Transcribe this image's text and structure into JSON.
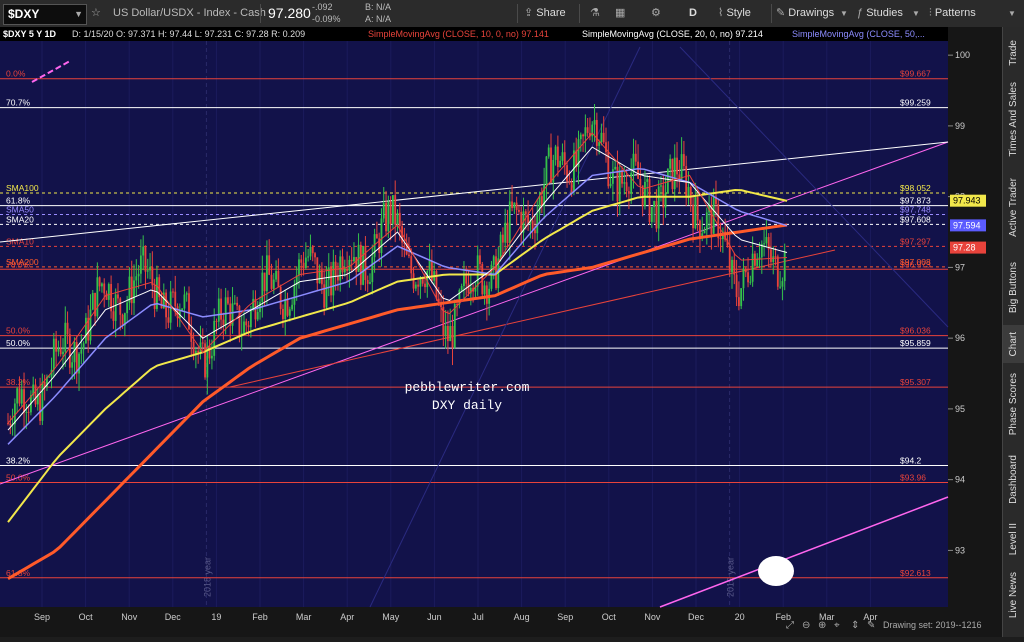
{
  "toolbar": {
    "symbol": "$DXY",
    "description": "US Dollar/USDX - Index - Cash",
    "last_price": "97.280",
    "change": "-.092",
    "change_pct": "-0.09%",
    "bid": "B: N/A",
    "ask": "A: N/A",
    "share_label": "Share",
    "period_label": "D",
    "style_label": "Style",
    "drawings_label": "Drawings",
    "studies_label": "Studies",
    "patterns_label": "Patterns"
  },
  "chart_header": {
    "symbol_period": "$DXY 5 Y 1D",
    "ohlc": "D: 1/15/20  O: 97.371  H: 97.44  L: 97.231  C: 97.28  R: 0.209",
    "sma10": "SimpleMovingAvg (CLOSE, 10, 0, no)  97.141",
    "sma20": "SimpleMovingAvg (CLOSE, 20, 0, no)  97.214",
    "sma50": "SimpleMovingAvg (CLOSE, 50,..."
  },
  "watermark": {
    "line1": "pebblewriter.com",
    "line2": "DXY daily"
  },
  "year_markers": [
    "2018 year",
    "2019 year"
  ],
  "fib_levels": [
    {
      "label": "0.0%",
      "value": "$99.667",
      "price": 99.667,
      "color": "#e8433b"
    },
    {
      "label": "70.7%",
      "value": "$99.259",
      "price": 99.259,
      "color": "#ffffff"
    },
    {
      "label": "61.8%",
      "value": "$97.873",
      "price": 97.873,
      "color": "#ffffff"
    },
    {
      "label": "78.6%",
      "value": "$96.973",
      "price": 96.973,
      "color": "#e8433b"
    },
    {
      "label": "50.0%",
      "value": "$96.036",
      "price": 96.036,
      "color": "#e8433b"
    },
    {
      "label": "50.0%",
      "value": "$95.859",
      "price": 95.859,
      "color": "#ffffff"
    },
    {
      "label": "38.2%",
      "value": "$95.307",
      "price": 95.307,
      "color": "#e8433b"
    },
    {
      "label": "38.2%",
      "value": "$94.2",
      "price": 94.2,
      "color": "#ffffff"
    },
    {
      "label": "50.0%",
      "value": "$93.96",
      "price": 93.96,
      "color": "#e8433b"
    },
    {
      "label": "61.8%",
      "value": "$92.613",
      "price": 92.613,
      "color": "#e8433b"
    }
  ],
  "sma_levels": [
    {
      "label": "SMA100",
      "value": "$98.052",
      "price": 98.052,
      "color": "#f2e84b"
    },
    {
      "label": "SMA50",
      "value": "$97.748",
      "price": 97.748,
      "color": "#9a8cff"
    },
    {
      "label": "SMA200",
      "value": "$97.008",
      "price": 97.008,
      "color": "#ff5a2a"
    },
    {
      "label": "SMA20",
      "value": "$97.608",
      "price": 97.608,
      "color": "#ffffff"
    },
    {
      "label": "SMA10",
      "value": "$97.297",
      "price": 97.297,
      "color": "#e8433b"
    }
  ],
  "price_axis": {
    "ticks": [
      "100",
      "99",
      "98",
      "97",
      "96",
      "95",
      "94",
      "93"
    ],
    "badges": [
      {
        "text": "97.943",
        "price": 97.943,
        "bg": "#f2e84b",
        "fg": "#000000"
      },
      {
        "text": "97.594",
        "price": 97.594,
        "bg": "#5b5bff",
        "fg": "#ffffff"
      },
      {
        "text": "97.28",
        "price": 97.28,
        "bg": "#e8433b",
        "fg": "#ffffff"
      }
    ]
  },
  "time_axis": {
    "labels": [
      "Sep",
      "Oct",
      "Nov",
      "Dec",
      "19",
      "Feb",
      "Mar",
      "Apr",
      "May",
      "Jun",
      "Jul",
      "Aug",
      "Sep",
      "Oct",
      "Nov",
      "Dec",
      "20",
      "Feb",
      "Mar",
      "Apr"
    ]
  },
  "drawing_set": "Drawing set: 2019--1216",
  "sidebar": {
    "tabs": [
      "Trade",
      "Times And Sales",
      "Active Trader",
      "Big Buttons",
      "Chart",
      "Phase Scores",
      "Dashboard",
      "Level II",
      "Live News"
    ],
    "active": "Chart"
  },
  "chart_data": {
    "type": "candlestick",
    "ylim": [
      92.2,
      100.2
    ],
    "x": [
      "Sep 2018",
      "Oct 2018",
      "Nov 2018",
      "Dec 2018",
      "Jan 2019",
      "Feb 2019",
      "Mar 2019",
      "Apr 2019",
      "May 2019",
      "Jun 2019",
      "Jul 2019",
      "Aug 2019",
      "Sep 2019",
      "Oct 2019",
      "Nov 2019",
      "Dec 2019",
      "Jan 2020"
    ],
    "series": [
      {
        "name": "$DXY",
        "values": [
          94.8,
          95.6,
          96.6,
          96.8,
          95.9,
          96.5,
          96.9,
          97.0,
          97.6,
          96.2,
          97.1,
          98.1,
          98.9,
          98.0,
          98.2,
          96.9,
          97.28
        ]
      },
      {
        "name": "SMA200",
        "values": [
          92.6,
          93.0,
          93.7,
          94.4,
          95.1,
          95.6,
          96.0,
          96.2,
          96.4,
          96.5,
          96.6,
          96.9,
          97.0,
          97.2,
          97.4,
          97.5,
          97.6
        ]
      },
      {
        "name": "SMA100",
        "values": [
          93.4,
          94.3,
          95.0,
          95.6,
          95.8,
          96.1,
          96.3,
          96.5,
          96.8,
          96.9,
          96.9,
          97.4,
          97.8,
          98.0,
          98.0,
          98.1,
          97.94
        ]
      },
      {
        "name": "SMA50",
        "values": [
          94.5,
          95.2,
          96.0,
          96.5,
          96.3,
          96.4,
          96.6,
          96.8,
          97.3,
          97.0,
          96.9,
          97.7,
          98.3,
          98.4,
          98.2,
          97.8,
          97.59
        ]
      },
      {
        "name": "SMA20",
        "values": [
          94.7,
          95.5,
          96.4,
          96.7,
          96.0,
          96.4,
          96.8,
          96.9,
          97.5,
          96.5,
          97.0,
          97.9,
          98.7,
          98.3,
          98.2,
          97.4,
          97.21
        ]
      },
      {
        "name": "SMA10",
        "values": [
          94.8,
          95.6,
          96.6,
          96.8,
          95.8,
          96.5,
          96.9,
          97.0,
          97.6,
          96.3,
          97.0,
          98.1,
          98.9,
          98.1,
          98.3,
          97.1,
          97.14
        ]
      }
    ]
  },
  "colors": {
    "background": "#12124a",
    "candle_up": "#35c24a",
    "candle_down": "#e8433b",
    "trendline_magenta": "#ff66ee",
    "trendline_white": "#ffffff",
    "trendline_red": "#e8433b"
  }
}
